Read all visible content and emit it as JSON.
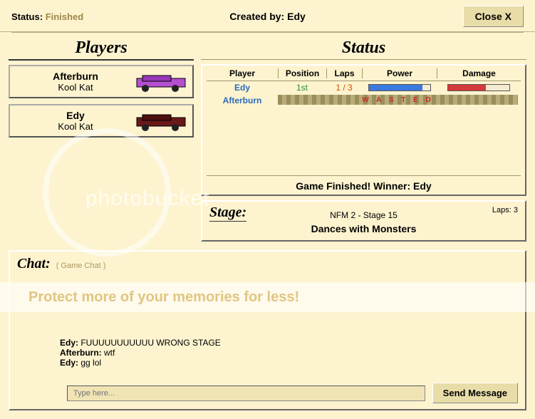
{
  "header": {
    "status_label": "Status:",
    "status_value": "Finished",
    "created_label": "Created by:",
    "created_value": "Edy",
    "close_label": "Close X"
  },
  "players_title": "Players",
  "status_title": "Status",
  "players": [
    {
      "name": "Afterburn",
      "sub": "Kool Kat",
      "car_color": "#b54fd0"
    },
    {
      "name": "Edy",
      "sub": "Kool Kat",
      "car_color": "#6a1818"
    }
  ],
  "status_table": {
    "headers": {
      "player": "Player",
      "position": "Position",
      "laps": "Laps",
      "power": "Power",
      "damage": "Damage"
    },
    "rows": [
      {
        "player": "Edy",
        "position": "1st",
        "laps": "1 / 3",
        "power_pct": 88,
        "damage_pct": 62,
        "wasted": false
      },
      {
        "player": "Afterburn",
        "position": "",
        "laps": "",
        "wasted": true,
        "wasted_text": "W A S T E D"
      }
    ],
    "finished_text": "Game Finished!   Winner:  Edy"
  },
  "stage": {
    "label": "Stage:",
    "info": "NFM 2 - Stage 15",
    "name": "Dances with Monsters",
    "laps": "Laps: 3"
  },
  "chat": {
    "title": "Chat:",
    "sub": "( Game Chat )",
    "messages": [
      {
        "sender": "Edy:",
        "text": " FUUUUUUUUUUU WRONG STAGE"
      },
      {
        "sender": "Afterburn:",
        "text": " wtf"
      },
      {
        "sender": "Edy:",
        "text": " gg lol"
      }
    ],
    "placeholder": "Type here...",
    "send_label": "Send Message"
  },
  "watermark": {
    "logo_text": "photobucket",
    "band_text": "Protect more of your memories for less!"
  }
}
